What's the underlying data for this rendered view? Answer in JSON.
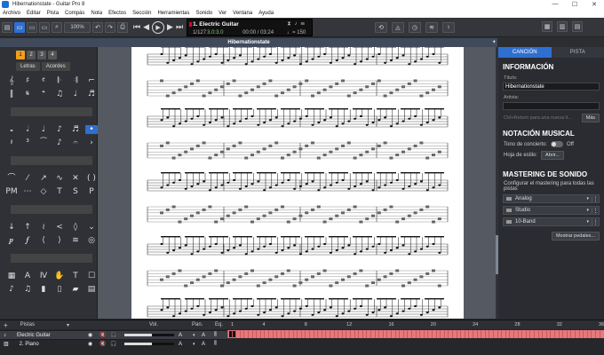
{
  "window": {
    "title": "Hibernationstate - Guitar Pro 8",
    "controls": [
      "—",
      "☐",
      "✕"
    ]
  },
  "menu": [
    "Archivo",
    "Editar",
    "Pista",
    "Compás",
    "Nota",
    "Efectos",
    "Sección",
    "Herramientas",
    "Sonido",
    "Ver",
    "Ventana",
    "Ayuda"
  ],
  "toolbar": {
    "zoom": "100%",
    "lcd": {
      "track": "1. Electric Guitar",
      "bar": "1/127",
      "signature": "3.0:3.0",
      "time": "00:00 / 03:24",
      "tempo_label": "♩= 150"
    }
  },
  "document_tab": "Hibernationstate",
  "edition": {
    "staff_numbers": [
      "1",
      "2",
      "3",
      "4"
    ],
    "voice_tabs": [
      "Letras",
      "Acordes"
    ]
  },
  "right_panel": {
    "tabs": [
      "CANCIÓN",
      "PISTA"
    ],
    "info_heading": "INFORMACIÓN",
    "title_label": "Título:",
    "title_value": "Hibernationstate",
    "artist_label": "Artista:",
    "artist_value": "",
    "hint": "Ctrl+Return para una nueva lí...",
    "more_button": "Más",
    "notation_heading": "NOTACIÓN MUSICAL",
    "concert_tone_label": "Tono de concierto:",
    "concert_tone_value": "Off",
    "style_label": "Hoja de estilo:",
    "style_button": "Abrir...",
    "mastering_heading": "MASTERING DE SONIDO",
    "mastering_desc": "Configurar el mastering para todas las pistas",
    "mastering_items": [
      "Analog",
      "Studio",
      "10-Band"
    ],
    "show_pedals": "Mostrar pedales..."
  },
  "tracks_panel": {
    "header": {
      "tracks_label": "Pistas",
      "vol_label": "Vol.",
      "pan_label": "Pan.",
      "eq_label": "Eq."
    },
    "tracks": [
      {
        "name": "Electric Guitar",
        "volume": 0.55
      },
      {
        "name": "2. Piano",
        "volume": 0.55
      }
    ],
    "ruler": [
      "1",
      "4",
      "8",
      "12",
      "16",
      "20",
      "24",
      "28",
      "32",
      "36"
    ]
  }
}
